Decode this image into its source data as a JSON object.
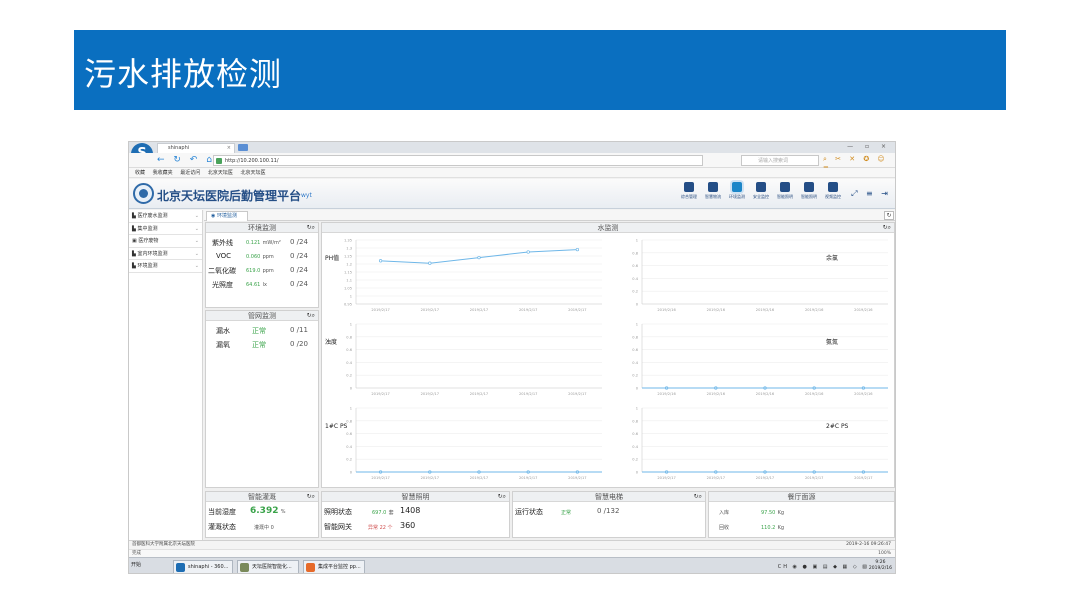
{
  "slide": {
    "title": "污水排放检测"
  },
  "browser": {
    "tab_title": "shinaphi",
    "tab_close": "×",
    "url": "http://10.200.100.11/",
    "search_placeholder": "请输入搜索词",
    "bookmarks": [
      "收藏",
      "我收藏夹",
      "最近访问",
      "北京天坛医",
      "北京天坛医"
    ]
  },
  "app": {
    "title": "北京天坛医院后勤管理平台",
    "user": "wyt",
    "modules": [
      {
        "label": "综合管理",
        "active": false
      },
      {
        "label": "智慧物流",
        "active": false
      },
      {
        "label": "环境监测",
        "active": true
      },
      {
        "label": "安全监控",
        "active": false
      },
      {
        "label": "智能照明",
        "active": false
      },
      {
        "label": "智能照明",
        "active": false
      },
      {
        "label": "视频监控",
        "active": false
      }
    ]
  },
  "sidebar": {
    "items": [
      {
        "label": "医疗废水监测"
      },
      {
        "label": "集中监测"
      },
      {
        "label": "医疗废物"
      },
      {
        "label": "室内环境监测"
      },
      {
        "label": "环境监测"
      }
    ]
  },
  "content_tab": "环境监测",
  "panels": {
    "env": {
      "title": "环境监测",
      "rows": [
        {
          "label": "紫外线",
          "value": "0.121",
          "unit": "mW/m²",
          "count": "0 /24"
        },
        {
          "label": "VOC",
          "value": "0.060",
          "unit": "ppm",
          "count": "0 /24"
        },
        {
          "label": "二氧化碳",
          "value": "619.0",
          "unit": "ppm",
          "count": "0 /24"
        },
        {
          "label": "光照度",
          "value": "64.61",
          "unit": "lx",
          "count": "0 /24"
        }
      ]
    },
    "pipe": {
      "title": "管网监测",
      "rows": [
        {
          "label": "漏水",
          "value": "正常",
          "count": "0 /11"
        },
        {
          "label": "漏氧",
          "value": "正常",
          "count": "0 /20"
        }
      ]
    },
    "water": {
      "title": "水监测"
    },
    "irrigation": {
      "title": "智能灌溉",
      "humidity_label": "当前湿度",
      "humidity_value": "6.392",
      "humidity_unit": "%",
      "status_label": "灌溉状态",
      "status_value": "灌溉中 0"
    },
    "lighting": {
      "title": "智慧照明",
      "status_label": "照明状态",
      "status_value": "697.0",
      "status_unit": "套",
      "status_count": "1408",
      "gateway_label": "智能网关",
      "gateway_value": "异常 22 个",
      "gateway_count": "360"
    },
    "elevator": {
      "title": "智慧电梯",
      "status_label": "运行状态",
      "status_value": "正常",
      "status_count": "0 /132"
    },
    "canteen": {
      "title": "餐厅面源",
      "in_label": "入库",
      "in_value": "97.50",
      "in_unit": "Kg",
      "out_label": "回收",
      "out_value": "110.2",
      "out_unit": "Kg"
    }
  },
  "chart_data": [
    {
      "type": "line",
      "title": "PH值",
      "categories": [
        "2019/2/17",
        "2019/2/17",
        "2019/2/17",
        "2019/2/17",
        "2019/2/17"
      ],
      "values": [
        1.22,
        1.205,
        1.24,
        1.275,
        1.29
      ],
      "ylim": [
        0.95,
        1.35
      ],
      "yticks": [
        "1.35",
        "1.3",
        "1.25",
        "1.2",
        "1.15",
        "1.1",
        "1.05",
        "1",
        "0.95"
      ],
      "color": "#6fb7e8"
    },
    {
      "type": "line",
      "title": "余氯",
      "categories": [
        "2019/2/16",
        "2019/2/16",
        "2019/2/16",
        "2019/2/16",
        "2019/2/16"
      ],
      "values": [],
      "ylim": [
        0,
        1
      ],
      "yticks": [
        "1",
        "0.8",
        "0.6",
        "0.4",
        "0.2",
        "0"
      ],
      "color": "#6fb7e8"
    },
    {
      "type": "line",
      "title": "浊度",
      "categories": [
        "2019/2/17",
        "2019/2/17",
        "2019/2/17",
        "2019/2/17",
        "2019/2/17"
      ],
      "values": [],
      "ylim": [
        0,
        1
      ],
      "yticks": [
        "1",
        "0.8",
        "0.6",
        "0.4",
        "0.2",
        "0"
      ],
      "color": "#6fb7e8"
    },
    {
      "type": "line",
      "title": "氨氮",
      "categories": [
        "2019/2/16",
        "2019/2/16",
        "2019/2/16",
        "2019/2/16",
        "2019/2/16"
      ],
      "values": [
        0,
        0,
        0,
        0,
        0
      ],
      "ylim": [
        0,
        1
      ],
      "yticks": [
        "1",
        "0.8",
        "0.6",
        "0.4",
        "0.2",
        "0"
      ],
      "color": "#6fb7e8"
    },
    {
      "type": "line",
      "title": "1#C PS",
      "categories": [
        "2019/2/17",
        "2019/2/17",
        "2019/2/17",
        "2019/2/17",
        "2019/2/17"
      ],
      "values": [
        0,
        0,
        0,
        0,
        0
      ],
      "ylim": [
        0,
        1
      ],
      "yticks": [
        "1",
        "0.8",
        "0.6",
        "0.4",
        "0.2",
        "0"
      ],
      "color": "#6fb7e8"
    },
    {
      "type": "line",
      "title": "2#C PS",
      "categories": [
        "2019/2/17",
        "2019/2/17",
        "2019/2/17",
        "2019/2/17",
        "2019/2/17"
      ],
      "values": [
        0,
        0,
        0,
        0,
        0
      ],
      "ylim": [
        0,
        1
      ],
      "yticks": [
        "1",
        "0.8",
        "0.6",
        "0.4",
        "0.2",
        "0"
      ],
      "color": "#6fb7e8"
    }
  ],
  "status": {
    "left": "首都医科大学附属北京天坛医院",
    "right": "2019-2-16 09:26:47",
    "dl_left": "完成",
    "dl_right": "100%"
  },
  "taskbar": {
    "start": "开始",
    "items": [
      "shinaphi - 360...",
      "天坛医院智能化...",
      "集成平台监控 pp..."
    ],
    "clock_time": "9:26",
    "clock_date": "2019/2/16"
  }
}
